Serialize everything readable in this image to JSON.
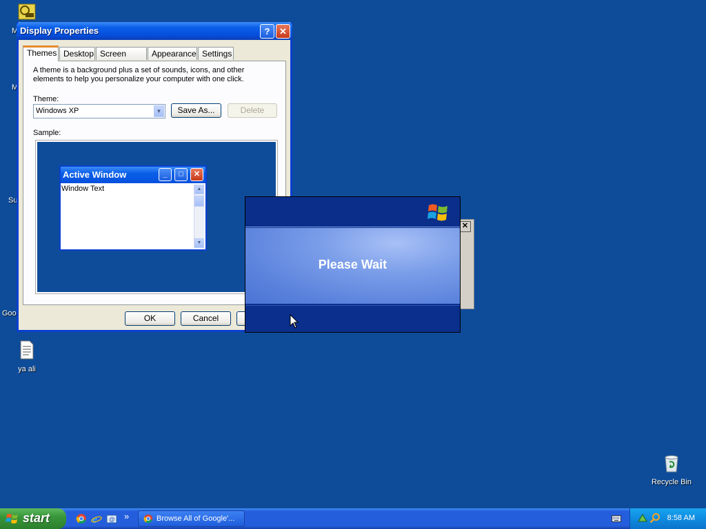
{
  "desktop": {
    "icons": [
      {
        "label": "ya ali",
        "icon": "text-document-icon"
      },
      {
        "label": "Recycle Bin",
        "icon": "recycle-bin-icon"
      }
    ],
    "partial_labels": [
      "M",
      "M",
      "Su",
      "Goo"
    ]
  },
  "display_properties": {
    "title": "Display Properties",
    "help_glyph": "?",
    "close_glyph": "✕",
    "tabs": [
      {
        "label": "Themes",
        "active": true
      },
      {
        "label": "Desktop",
        "active": false
      },
      {
        "label": "Screen Saver",
        "active": false
      },
      {
        "label": "Appearance",
        "active": false
      },
      {
        "label": "Settings",
        "active": false
      }
    ],
    "description": "A theme is a background plus a set of sounds, icons, and other elements to help you personalize your computer with one click.",
    "theme_label": "Theme:",
    "theme_value": "Windows XP",
    "save_as_label": "Save As...",
    "delete_label": "Delete",
    "sample_label": "Sample:",
    "sample_window": {
      "title": "Active Window",
      "text": "Window Text"
    },
    "ok_label": "OK",
    "cancel_label": "Cancel"
  },
  "please_wait": {
    "message": "Please Wait",
    "close_glyph": "✕"
  },
  "taskbar": {
    "start_label": "start",
    "quick_launch": [
      "chrome-icon",
      "internet-explorer-icon",
      "outlook-express-icon"
    ],
    "chevron": "»",
    "task_item_label": "Browse All of Google'...",
    "clock": "8:58 AM"
  },
  "colors": {
    "desktop": "#0e4c9a",
    "titlebar": "#0a5fe8",
    "taskbar": "#245edc",
    "start": "#38963a"
  }
}
